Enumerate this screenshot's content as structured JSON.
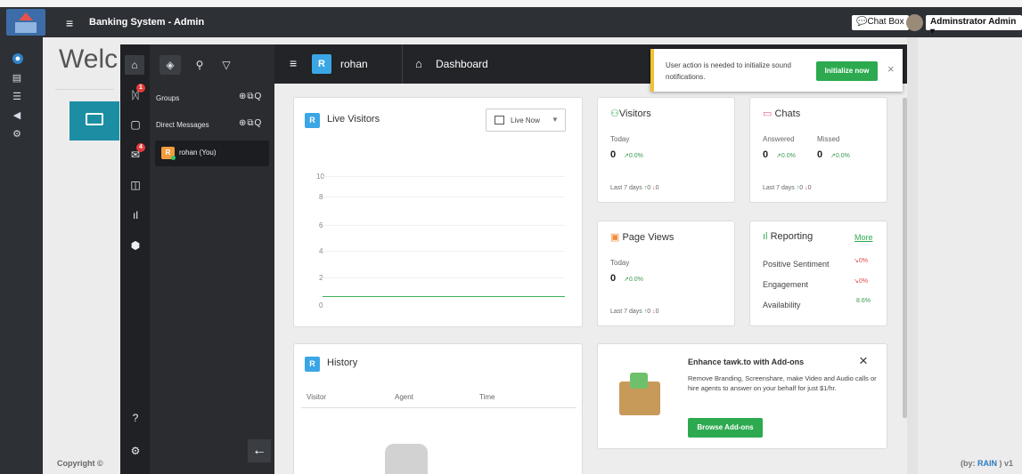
{
  "topbar": {
    "menu_icon": "hamburger-icon",
    "title": "Banking System - Admin",
    "chat_box": "Chat Box",
    "admin_user": "Adminstrator Admin"
  },
  "background_page": {
    "welcome": "Welc",
    "copyright": "Copyright ©",
    "footer_by": "(by: ",
    "footer_rain": "RAIN",
    "footer_version": " ) v1"
  },
  "side_panel": {
    "groups_label": "Groups",
    "direct_messages_label": "Direct Messages",
    "actions": "⊕⧉Q",
    "user_avatar": "R",
    "user_name": "rohan (You)",
    "alert_badge": "1",
    "inbox_badge": "4"
  },
  "header": {
    "avatar": "R",
    "user": "rohan",
    "section": "Dashboard"
  },
  "notification": {
    "message": "User action is needed to initialize sound notifications.",
    "button": "Initialize now",
    "close": "×"
  },
  "live_visitors": {
    "badge": "R",
    "title": "Live Visitors",
    "filter": "Live Now",
    "y_ticks": [
      "10",
      "8",
      "6",
      "4",
      "2",
      "0"
    ]
  },
  "visitors": {
    "title": "Visitors",
    "today_label": "Today",
    "value": "0",
    "change": "0.0%",
    "last7": "Last 7 days",
    "up": "0",
    "down": "0"
  },
  "chats": {
    "title": "Chats",
    "answered_label": "Answered",
    "missed_label": "Missed",
    "answered_value": "0",
    "answered_change": "0.0%",
    "missed_value": "0",
    "missed_change": "0.0%",
    "last7": "Last 7 days",
    "up": "0",
    "down": "0"
  },
  "page_views": {
    "title": "Page Views",
    "today_label": "Today",
    "value": "0",
    "change": "0.0%",
    "last7": "Last 7 days",
    "up": "0",
    "down": "0"
  },
  "reporting": {
    "title": "Reporting",
    "more": "More",
    "rows": [
      {
        "label": "Positive Sentiment",
        "value": "0%"
      },
      {
        "label": "Engagement",
        "value": "0%"
      },
      {
        "label": "Availability",
        "value": "8.6%"
      }
    ]
  },
  "history": {
    "badge": "R",
    "title": "History",
    "columns": [
      "Visitor",
      "Agent",
      "Time"
    ]
  },
  "addons": {
    "title": "Enhance tawk.to with Add-ons",
    "description": "Remove Branding, Screenshare, make Video and Audio calls or hire agents to answer on your behalf for just $1/hr.",
    "button": "Browse Add-ons",
    "close": "×"
  },
  "colors": {
    "topbar": "#2d3035",
    "accent_green": "#2daa4f",
    "accent_blue": "#3ba6e5",
    "notice_yellow": "#f2c132"
  }
}
